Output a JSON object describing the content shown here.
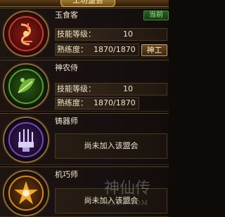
{
  "panel": {
    "title": "工坊盟会"
  },
  "labels": {
    "skill_level": "技能等级：",
    "proficiency": "熟练度："
  },
  "professions": [
    {
      "name": "玉食客",
      "status": "当前",
      "skill_level": "10",
      "proficiency": "1870/1870",
      "action": "神工",
      "icon": "cook-emblem-icon",
      "color": "#b03020"
    },
    {
      "name": "神农侍",
      "skill_level": "10",
      "proficiency": "1870/1870",
      "icon": "herbalist-emblem-icon",
      "color": "#4a9a2a"
    },
    {
      "name": "铸器师",
      "notice": "尚未加入该盟会",
      "icon": "smith-emblem-icon",
      "color": "#6a3aa0"
    },
    {
      "name": "机巧师",
      "notice": "尚未加入该盟会",
      "icon": "craftsman-emblem-icon",
      "color": "#d08a20"
    }
  ],
  "watermark": {
    "text": "神仙传",
    "url": "SXDS.COM"
  }
}
